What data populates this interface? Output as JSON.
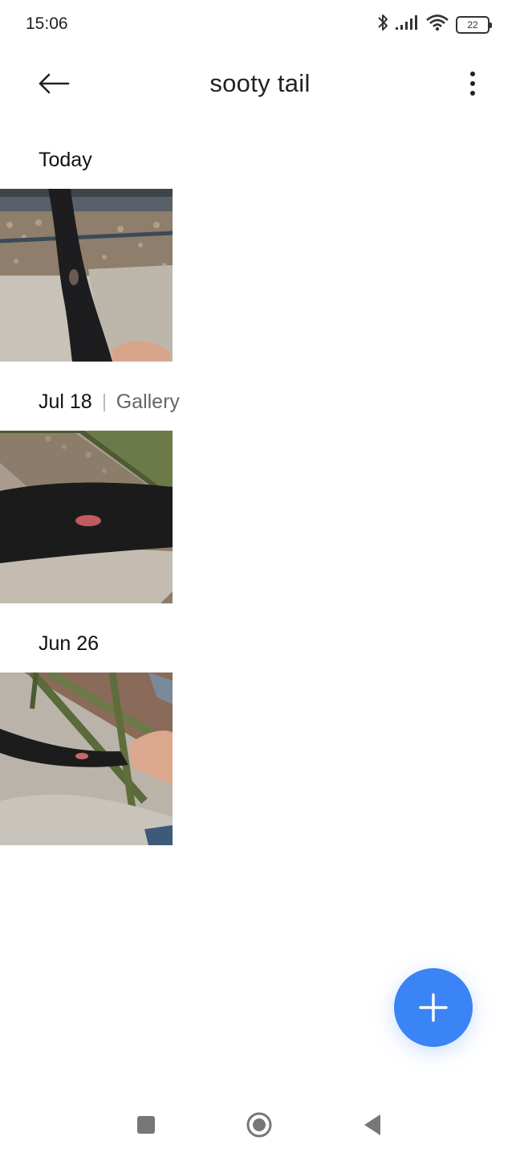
{
  "status_bar": {
    "time": "15:06",
    "battery": "22",
    "icons": [
      "bluetooth-icon",
      "signal-icon",
      "wifi-icon",
      "battery-icon"
    ]
  },
  "app_bar": {
    "title": "sooty tail",
    "back_icon": "arrow-left-icon",
    "more_icon": "more-vertical-icon"
  },
  "sections": [
    {
      "date": "Today",
      "source": ""
    },
    {
      "date": "Jul 18",
      "source": "Gallery"
    },
    {
      "date": "Jun 26",
      "source": ""
    }
  ],
  "fab": {
    "icon": "plus-icon",
    "color": "#3a84f5"
  },
  "nav_bar": {
    "icons": [
      "recents-square-icon",
      "home-circle-icon",
      "back-triangle-icon"
    ]
  }
}
